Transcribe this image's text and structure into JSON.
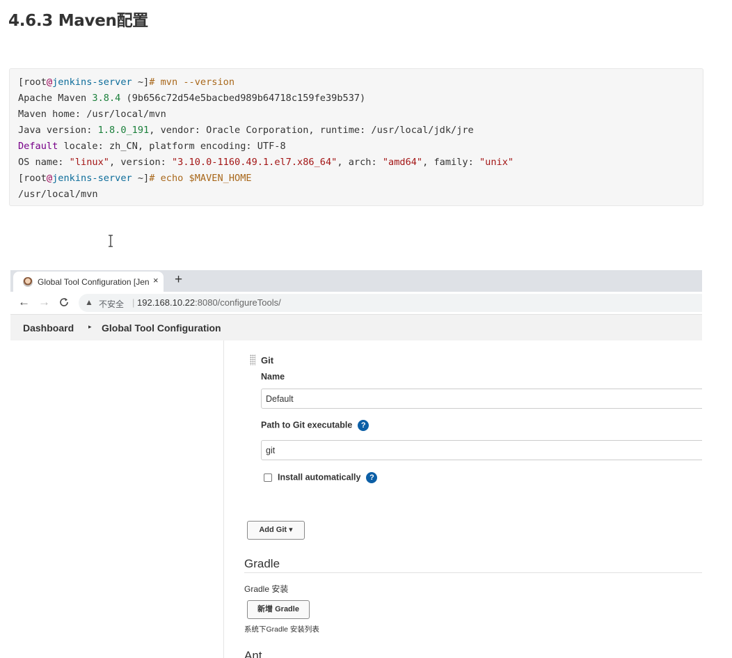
{
  "doc": {
    "heading": "4.6.3 Maven配置",
    "code_lines": [
      [
        {
          "t": "[root",
          "c": "c-prompt"
        },
        {
          "t": "@",
          "c": "c-at"
        },
        {
          "t": "jenkins-server",
          "c": "c-host"
        },
        {
          "t": " ~]",
          "c": "c-prompt"
        },
        {
          "t": "# mvn --version",
          "c": "c-cmd"
        }
      ],
      [
        {
          "t": "Apache Maven ",
          "c": "c-path"
        },
        {
          "t": "3.8.4",
          "c": "c-num"
        },
        {
          "t": " (9b656c72d54e5bacbed989b64718c159fe39b537)",
          "c": "c-path"
        }
      ],
      [
        {
          "t": "Maven home: ",
          "c": "c-path"
        },
        {
          "t": "/usr/local/mvn",
          "c": "c-path"
        }
      ],
      [
        {
          "t": "Java version: ",
          "c": "c-path"
        },
        {
          "t": "1.8.0_191",
          "c": "c-num"
        },
        {
          "t": ", vendor: Oracle Corporation, runtime: /usr/local/jdk/jre",
          "c": "c-path"
        }
      ],
      [
        {
          "t": "Default",
          "c": "c-kw"
        },
        {
          "t": " locale: zh_CN, platform encoding: UTF-8",
          "c": "c-path"
        }
      ],
      [
        {
          "t": "OS name: ",
          "c": "c-path"
        },
        {
          "t": "\"linux\"",
          "c": "c-str"
        },
        {
          "t": ", version: ",
          "c": "c-path"
        },
        {
          "t": "\"3.10.0-1160.49.1.el7.x86_64\"",
          "c": "c-str"
        },
        {
          "t": ", arch: ",
          "c": "c-path"
        },
        {
          "t": "\"amd64\"",
          "c": "c-str"
        },
        {
          "t": ", family: ",
          "c": "c-path"
        },
        {
          "t": "\"unix\"",
          "c": "c-str"
        }
      ],
      [
        {
          "t": "[root",
          "c": "c-prompt"
        },
        {
          "t": "@",
          "c": "c-at"
        },
        {
          "t": "jenkins-server",
          "c": "c-host"
        },
        {
          "t": " ~]",
          "c": "c-prompt"
        },
        {
          "t": "# echo ",
          "c": "c-cmd"
        },
        {
          "t": "$MAVEN_HOME",
          "c": "c-var"
        }
      ],
      [
        {
          "t": "/usr/local/mvn",
          "c": "c-path"
        }
      ]
    ]
  },
  "browser": {
    "tab_title": "Global Tool Configuration [Jenkins]",
    "close_glyph": "×",
    "new_tab_glyph": "+",
    "back_glyph": "←",
    "forward_glyph": "→",
    "reload_glyph": "C",
    "warning_glyph": "▲",
    "insecure_label": "不安全",
    "separator": "|",
    "url_host": "192.168.10.22",
    "url_rest": ":8080/configureTools/"
  },
  "jenkins": {
    "breadcrumb_1": "Dashboard",
    "breadcrumb_arrow": "▸",
    "breadcrumb_2": "Global Tool Configuration",
    "git": {
      "title": "Git",
      "name_label": "Name",
      "name_value": "Default",
      "path_label": "Path to Git executable",
      "path_value": "git",
      "install_label": "Install automatically",
      "add_button": "Add Git ▾"
    },
    "help_glyph": "?",
    "gradle": {
      "title": "Gradle",
      "install_label": "Gradle 安装",
      "add_button": "新增 Gradle",
      "desc": "系统下Gradle 安装列表"
    },
    "next_section": "Ant"
  }
}
